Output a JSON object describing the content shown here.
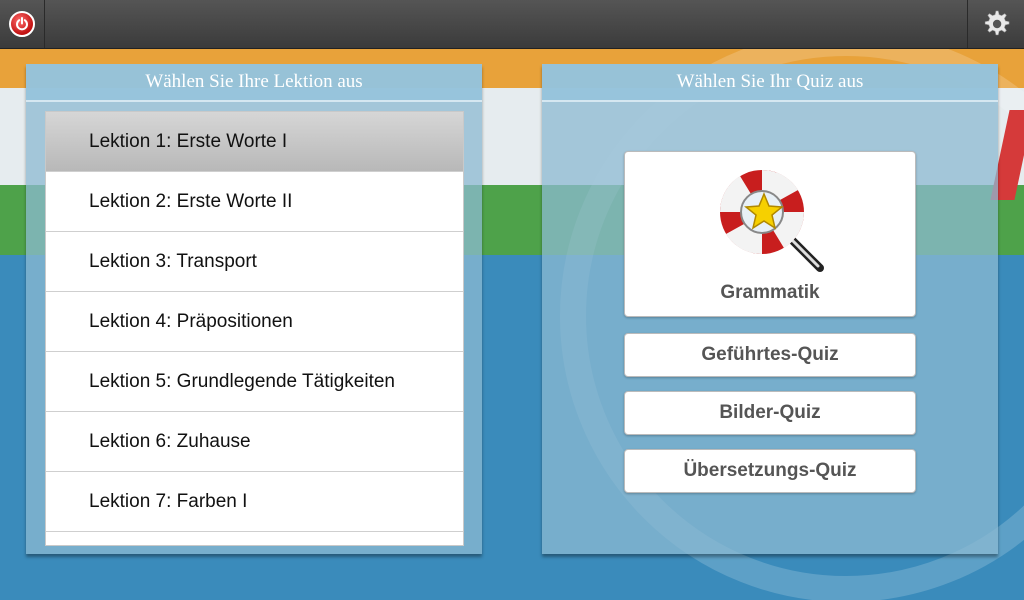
{
  "topbar": {
    "power_icon": "power-icon",
    "settings_icon": "gear-icon"
  },
  "lessons_panel": {
    "title": "Wählen Sie Ihre Lektion aus",
    "items": [
      {
        "label": "Lektion 1: Erste Worte I",
        "selected": true
      },
      {
        "label": "Lektion 2: Erste Worte II",
        "selected": false
      },
      {
        "label": "Lektion 3: Transport",
        "selected": false
      },
      {
        "label": "Lektion 4: Präpositionen",
        "selected": false
      },
      {
        "label": "Lektion 5: Grundlegende Tätigkeiten",
        "selected": false
      },
      {
        "label": "Lektion 6: Zuhause",
        "selected": false
      },
      {
        "label": "Lektion 7: Farben I",
        "selected": false
      }
    ]
  },
  "quiz_panel": {
    "title": "Wählen Sie Ihr Quiz aus",
    "grammar": {
      "label": "Grammatik",
      "icon": "lifebuoy-magnifier-star-icon"
    },
    "guided": {
      "label": "Geführtes-Quiz"
    },
    "picture": {
      "label": "Bilder-Quiz"
    },
    "translation": {
      "label": "Übersetzungs-Quiz"
    }
  },
  "colors": {
    "topbar": "#3b3b3b",
    "panel": "#8cb9d2",
    "accent_red": "#c01010",
    "button_text": "#555555"
  }
}
